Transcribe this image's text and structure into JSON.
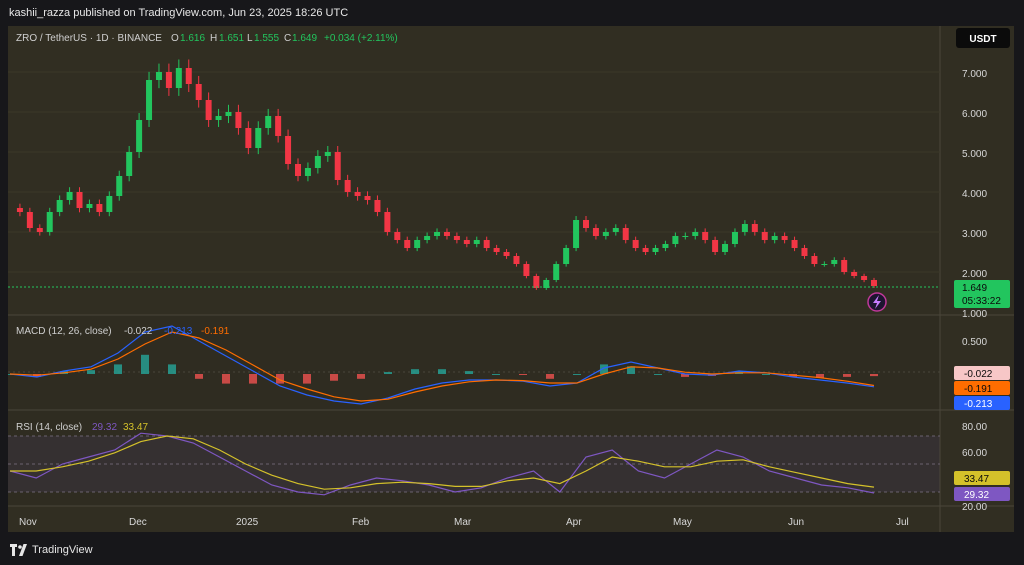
{
  "header": {
    "publisher": "kashii_razza published on TradingView.com, Jun 23, 2025 18:26 UTC"
  },
  "main": {
    "symbol": "ZRO / TetherUS · 1D · BINANCE",
    "ohlc": {
      "o_label": "O",
      "o": "1.616",
      "h_label": "H",
      "h": "1.651",
      "l_label": "L",
      "l": "1.555",
      "c_label": "C",
      "c": "1.649",
      "change": "+0.034 (+2.11%)"
    },
    "currency_button": "USDT",
    "price_ticks": [
      "7.000",
      "6.000",
      "5.000",
      "4.000",
      "3.000",
      "2.000",
      "1.000"
    ],
    "last_price": "1.649",
    "countdown": "05:33:22"
  },
  "macd": {
    "label": "MACD (12, 26, close)",
    "v1": "-0.022",
    "v2": "-0.213",
    "v3": "-0.191",
    "tick": "0.500",
    "badge_hist": "-0.022",
    "badge_signal": "-0.191",
    "badge_macd": "-0.213"
  },
  "rsi": {
    "label": "RSI (14, close)",
    "v1": "29.32",
    "v2": "33.47",
    "ticks": [
      "80.00",
      "60.00",
      "20.00"
    ],
    "badge_ma": "33.47",
    "badge_rsi": "29.32"
  },
  "time_axis": [
    "Nov",
    "Dec",
    "2025",
    "Feb",
    "Mar",
    "Apr",
    "May",
    "Jun",
    "Jul"
  ],
  "brand": "TradingView",
  "colors": {
    "up": "#22c55e",
    "down": "#f23645",
    "macd": "#2962ff",
    "signal": "#ff6d00",
    "rsi": "#7e57c2",
    "rsi_ma": "#d4c12a",
    "price_badge": "#22c55e"
  },
  "chart_data": [
    {
      "type": "candlestick",
      "title": "ZRO / TetherUS · 1D · BINANCE",
      "ylim": [
        1.0,
        7.5
      ],
      "close_series": [
        3.6,
        3.5,
        3.1,
        3.0,
        3.5,
        3.8,
        4.0,
        3.6,
        3.7,
        3.5,
        3.9,
        4.4,
        5.0,
        5.8,
        6.8,
        7.0,
        6.6,
        7.1,
        6.7,
        6.3,
        5.8,
        5.9,
        6.0,
        5.6,
        5.1,
        5.6,
        5.9,
        5.4,
        4.7,
        4.4,
        4.6,
        4.9,
        5.0,
        4.3,
        4.0,
        3.9,
        3.8,
        3.5,
        3.0,
        2.8,
        2.6,
        2.8,
        2.9,
        3.0,
        2.9,
        2.8,
        2.7,
        2.8,
        2.6,
        2.5,
        2.4,
        2.2,
        1.9,
        1.6,
        1.8,
        2.2,
        2.6,
        3.3,
        3.1,
        2.9,
        3.0,
        3.1,
        2.8,
        2.6,
        2.5,
        2.6,
        2.7,
        2.9,
        2.9,
        3.0,
        2.8,
        2.5,
        2.7,
        3.0,
        3.2,
        3.0,
        2.8,
        2.9,
        2.8,
        2.6,
        2.4,
        2.2,
        2.2,
        2.3,
        2.0,
        1.9,
        1.8,
        1.65
      ]
    },
    {
      "type": "line",
      "title": "MACD (12, 26, close)",
      "series": [
        {
          "name": "MACD",
          "values": [
            0.0,
            -0.05,
            0.05,
            0.12,
            0.35,
            0.7,
            0.8,
            0.55,
            0.3,
            0.05,
            -0.2,
            -0.35,
            -0.45,
            -0.5,
            -0.4,
            -0.25,
            -0.15,
            -0.1,
            -0.1,
            -0.12,
            -0.2,
            -0.15,
            0.1,
            0.2,
            0.1,
            0.0,
            -0.02,
            0.05,
            0.02,
            -0.05,
            -0.1,
            -0.15,
            -0.213
          ]
        },
        {
          "name": "Signal",
          "values": [
            0.0,
            -0.02,
            0.02,
            0.08,
            0.25,
            0.5,
            0.7,
            0.6,
            0.4,
            0.15,
            -0.1,
            -0.25,
            -0.38,
            -0.45,
            -0.42,
            -0.3,
            -0.2,
            -0.13,
            -0.1,
            -0.11,
            -0.15,
            -0.15,
            0.0,
            0.12,
            0.1,
            0.03,
            0.0,
            0.02,
            0.02,
            -0.02,
            -0.06,
            -0.12,
            -0.191
          ]
        }
      ],
      "ylim": [
        -0.6,
        0.9
      ]
    },
    {
      "type": "line",
      "title": "RSI (14, close)",
      "series": [
        {
          "name": "RSI",
          "values": [
            45,
            40,
            50,
            55,
            60,
            72,
            70,
            65,
            55,
            45,
            35,
            30,
            28,
            35,
            40,
            38,
            35,
            30,
            33,
            40,
            45,
            30,
            55,
            60,
            45,
            40,
            50,
            60,
            55,
            45,
            40,
            35,
            33,
            29.32
          ]
        },
        {
          "name": "RSI-based MA",
          "values": [
            45,
            45,
            48,
            52,
            58,
            66,
            70,
            68,
            60,
            50,
            42,
            36,
            32,
            33,
            36,
            37,
            36,
            34,
            34,
            38,
            40,
            36,
            45,
            55,
            52,
            48,
            48,
            52,
            53,
            48,
            44,
            40,
            36,
            33.47
          ]
        }
      ],
      "ylim": [
        20,
        80
      ]
    }
  ]
}
